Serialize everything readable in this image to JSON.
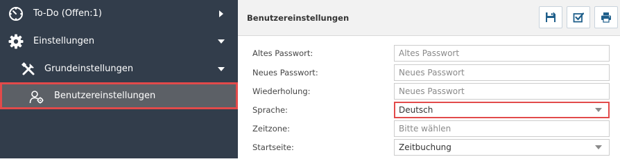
{
  "sidebar": {
    "items": [
      {
        "label": "To-Do (Offen:1)",
        "icon": "clock-icon",
        "caret": "caret-right"
      },
      {
        "label": "Einstellungen",
        "icon": "gear-icon",
        "caret": "caret-down"
      },
      {
        "label": "Grundeinstellungen",
        "icon": "tools-icon",
        "caret": "caret-down"
      },
      {
        "label": "Benutzereinstellungen",
        "icon": "user-settings-icon",
        "selected": true
      }
    ]
  },
  "main": {
    "title": "Benutzereinstellungen",
    "toolbar": [
      "save-icon",
      "checkbox-icon",
      "print-icon"
    ],
    "form": {
      "old_password": {
        "label": "Altes Passwort:",
        "placeholder": "Altes Passwort"
      },
      "new_password": {
        "label": "Neues Passwort:",
        "placeholder": "Neues Passwort"
      },
      "repeat_password": {
        "label": "Wiederholung:",
        "placeholder": "Neues Passwort"
      },
      "language": {
        "label": "Sprache:",
        "value": "Deutsch"
      },
      "timezone": {
        "label": "Zeitzone:",
        "placeholder": "Bitte wählen"
      },
      "start_page": {
        "label": "Startseite:",
        "value": "Zeitbuchung"
      }
    }
  },
  "colors": {
    "sidebar_bg": "#323d4b",
    "selected_bg": "#5c6066",
    "highlight": "#e24a4a",
    "icon_blue": "#1f5f8b"
  }
}
